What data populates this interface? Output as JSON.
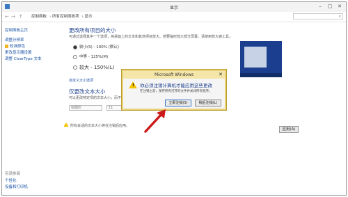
{
  "window": {
    "title": "显示"
  },
  "address": {
    "back": "←",
    "forward": "→",
    "up": "↑",
    "crumbs": [
      "控制面板",
      "所有控制面板项",
      "显示"
    ]
  },
  "sidebar": {
    "home": "控制面板主页",
    "items": [
      "调整分辨率",
      "校准颜色",
      "更改显示器设置",
      "调整 ClearType 文本"
    ],
    "see_also": "另请参阅",
    "see_also_items": [
      "个性化",
      "设备和打印机"
    ]
  },
  "main": {
    "heading": "更改所有项目的大小",
    "desc": "可通过选择其中一个选项，将桌面上的文本和其他项目放大。若要临时放大部分屏幕，请使用放大镜工具。",
    "options": [
      {
        "label": "较小(S) - 100% (默认)",
        "selected": true
      },
      {
        "label": "中等 - 125%(M)",
        "selected": false
      },
      {
        "label": "较大 - 150%(L)",
        "selected": false
      }
    ],
    "custom_link": "自定义大小选项",
    "text_heading": "仅更改文本大小",
    "text_desc": "可以更改特定项的文本大小，而不是更改桌面上所有项的大小。",
    "item_select": "标题栏",
    "size_select": "11",
    "bold_label": "粗体",
    "warn_note": "所有会话的文本大小将在注销后应用。",
    "apply": "应用(A)"
  },
  "dialog": {
    "title": "Microsoft Windows",
    "message": "你必须注销计算机才能应用这些更改",
    "sub": "在注销之前，保存所有打开的文件并关闭所有程序。",
    "btn_logoff": "立即注销(S)",
    "btn_later": "稍后注销(L)"
  },
  "colors": {
    "accent": "#1b3f8e",
    "dialog_border": "#e8d27a",
    "arrow": "#cc1a1a"
  }
}
